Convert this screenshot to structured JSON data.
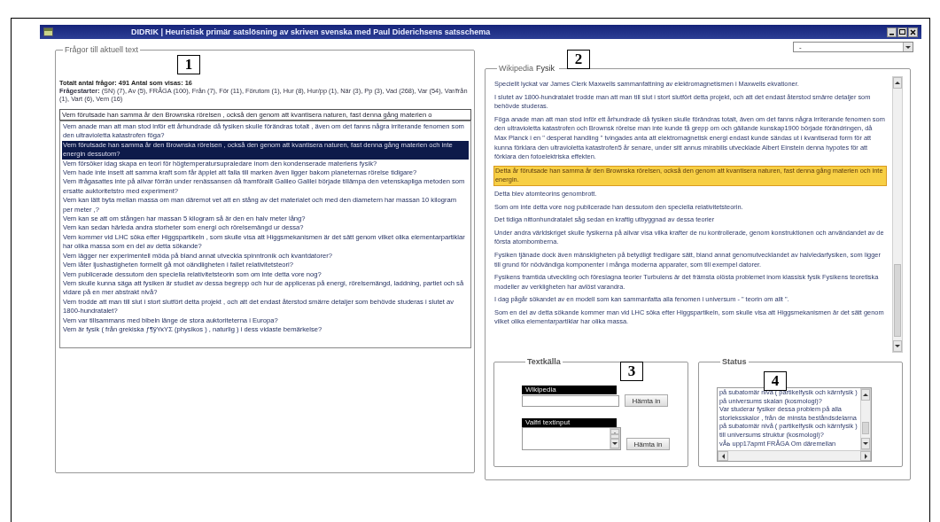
{
  "window": {
    "title": "DIDRIK | Heuristisk primär satslösning av skriven svenska med Paul Diderichsens satsschema"
  },
  "view_select": {
    "value": "-"
  },
  "questions_panel": {
    "legend": "Frågor till aktuell text",
    "summary": "Totalt antal frågor: 491 Antal som visas: 16",
    "starters": "**Frågestarter:** (SN) (7), Av (5), FRÅGA (100), Från (7), För (11), Förutom (1), Hur (8), Hur/pp (1), När (3), Pp (3), Vad (268), Var (54), Var/från (1), Vart (6), Vem (16)",
    "current_question": "Vem förutsade han samma år den Brownska rörelsen , också den genom att kvantisera naturen, fast denna gång materien o",
    "questions": [
      {
        "text": "Vem anade man att man stod inför ett århundrade då fysiken skulle förändras totalt , även om det fanns några irriterande fenomen som den ultravioletta katastrofen föga?",
        "selected": false
      },
      {
        "text": "Vem förutsade han samma år den Brownska rörelsen , också den genom att kvantisera naturen, fast denna gång materien och inte energin dessutom?",
        "selected": true
      },
      {
        "text": "Vem försöker idag skapa en teori för högtemperatursupraledare inom den kondenserade materiens fysik?",
        "selected": false
      },
      {
        "text": "Vem hade inte insett att samma kraft som får äpplet att falla till marken även ligger bakom planeternas rörelse tidigare?",
        "selected": false
      },
      {
        "text": "Vem ifrågasattes inte på allvar förrän under renässansen då framförallt Galileo Galilei började tillämpa den vetenskapliga metoden som ersatte auktoritetstro med experiment?",
        "selected": false
      },
      {
        "text": "Vem kan lätt byta mellan massa om man däremot vet att en stång av det materialet och med den diametern har massan 10 kilogram per meter ,?",
        "selected": false
      },
      {
        "text": "Vem kan se att om stången har massan 5 kilogram så är den en halv meter lång?",
        "selected": false
      },
      {
        "text": "Vem kan sedan härleda andra storheter som energi och rörelsemängd ur dessa?",
        "selected": false
      },
      {
        "text": "Vem kommer vid LHC söka efter Higgspartikeln , som skulle visa att Higgsmekanismen är det sätt genom vilket olika elementarpartiklar har olika massa som en del av detta sökande?",
        "selected": false
      },
      {
        "text": "Vem lägger ner experimentell möda på bland annat utveckla spinntronik och kvantdatorer?",
        "selected": false
      },
      {
        "text": "Vem låter ljushastigheten formellt gå mot oändligheten i fallet relativitetsteori?",
        "selected": false
      },
      {
        "text": "Vem publicerade dessutom den speciella relativitetsteorin som om inte detta vore nog?",
        "selected": false
      },
      {
        "text": "Vem skulle kunna säga att fysiken är studiet av dessa begrepp och hur de appliceras på energi, rörelsemängd, laddning, partiet och så vidare på en mer abstrakt nivå?",
        "selected": false
      },
      {
        "text": "Vem trodde att man till slut i stort slutfört detta projekt , och att det endast återstod smärre detaljer som behövde studeras i slutet av 1800-hundratalet?",
        "selected": false
      },
      {
        "text": "Vem var tillsammans med bibeln länge de stora auktoriteterna i Europa?",
        "selected": false
      },
      {
        "text": "Vem är fysik ( från grekiska ƒ¶ÿΥκΥΣ (physikos ) , naturlig ) i dess vidaste bemärkelse?",
        "selected": false
      }
    ]
  },
  "article_panel": {
    "source": "Wikipedia",
    "title": "Fysik",
    "paragraphs": [
      {
        "text": "Speciellt lyckat var James Clerk Maxwells sammanfattning av elektromagnetismen i Maxwells ekvationer.",
        "highlighted": false
      },
      {
        "text": "I slutet av 1800-hundratalet trodde man att man till slut i stort slutfört detta projekt, och att det endast återstod smärre detaljer som behövde studeras.",
        "highlighted": false
      },
      {
        "text": "Föga anade man att man stod inför ett århundrade då fysiken skulle förändras totalt, även om det fanns några irriterande fenomen som den ultravioletta katastrofen och Brownsk rörelse man inte kunde få grepp om och gällande kunskap1900 började förändringen, då Max Planck i en \" desperat handling \" tvingades anta att elektromagnetisk energi endast kunde sändas ut i kvantiserad form för att kunna förklara den ultravioletta katastrofen5 år senare, under sitt annus mirabilis utvecklade Albert Einstein denna hypotes för att förklara den fotoelektriska effekten.",
        "highlighted": false
      },
      {
        "text": "Detta år förutsade han samma år den Brownska rörelsen, också den genom att kvantisera naturen, fast denna gång materien och inte energin.",
        "highlighted": true
      },
      {
        "text": "Detta blev atomteorins genombrott.",
        "highlighted": false
      },
      {
        "text": "Som om inte detta vore nog publicerade han dessutom den speciella relativitetsteorin.",
        "highlighted": false
      },
      {
        "text": "Det tidiga nittonhundratalet såg sedan en kraftig utbyggnad av dessa teorier",
        "highlighted": false
      },
      {
        "text": "Under andra världskriget skulle fysikerna på allvar visa vilka krafter de nu kontrollerade, genom konstruktionen och användandet av de första atombomberna.",
        "highlighted": false
      },
      {
        "text": "Fysiken tjänade dock även mänskligheten på betydligt fredligare sätt, bland annat genomutvecklandet av halvledarfysiken, som ligger till grund för nödvändiga komponenter i många moderna apparater, som till exempel datorer.",
        "highlighted": false
      },
      {
        "text": "Fysikens framtida utveckling och föreslagna teorier Turbulens är det främsta olösta problemet inom klassisk fysik Fysikens teoretiska modeller av verkligheten har avlöst varandra.",
        "highlighted": false
      },
      {
        "text": "I dag pågår sökandet av en modell som kan sammanfatta alla fenomen i universum - \" teorin om allt \".",
        "highlighted": false
      },
      {
        "text": "Som en del av detta sökande kommer man vid LHC söka efter Higgspartikeln, som skulle visa att Higgsmekanismen är det sätt genom vilket olika elementarpartiklar har olika massa.",
        "highlighted": false
      }
    ]
  },
  "source_panel": {
    "legend": "Textkälla",
    "wikipedia_label": "Wikipedia",
    "wikipedia_button": "Hämta in",
    "free_label": "Valfri textinput",
    "free_button": "Hämta in"
  },
  "status_panel": {
    "legend": "Status",
    "log": "på subatomär nivå ( partikelfysik och kärnfysik ) på universums skalan (kosmologi)?\nVar studerar fysiker dessa problem på alla storleksskalor , från de minsta beståndsdelarna på subatomär nivå ( partikelfysik och kärnfysik ) till universums struktur (kosmologi)?\nvÅь upp17apmt FRÅGA Om däremellan"
  },
  "callouts": [
    "1",
    "2",
    "3",
    "4"
  ]
}
